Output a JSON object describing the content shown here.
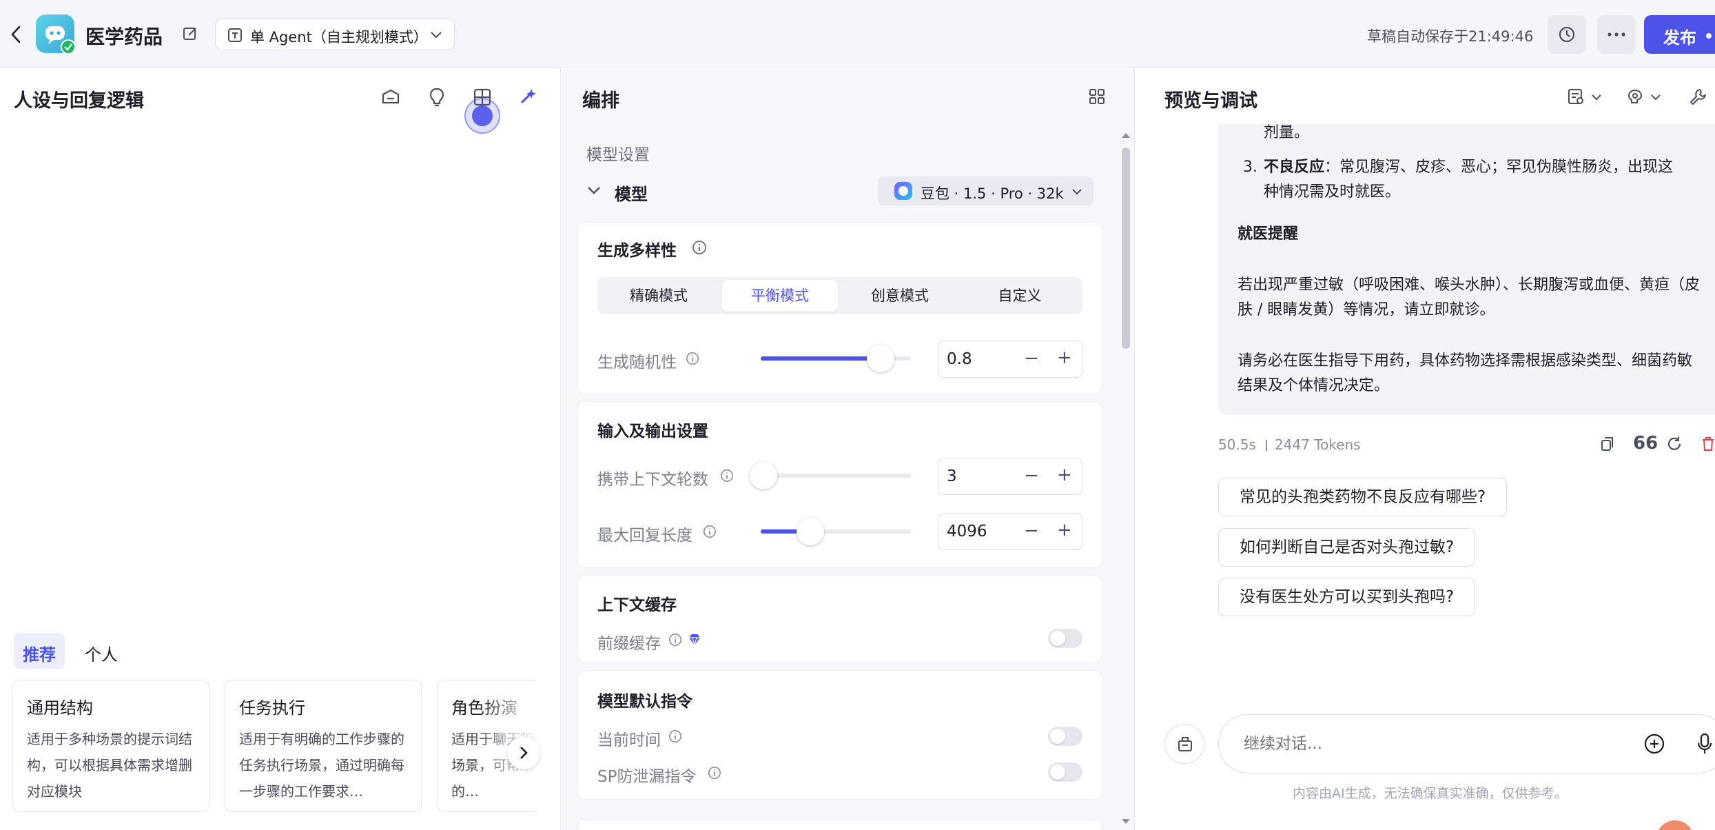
{
  "app": {
    "title": "医学药品",
    "agent_mode": "单 Agent（自主规划模式）",
    "autosave": "草稿自动保存于21:49:46",
    "publish_label": "发布"
  },
  "left": {
    "title": "人设与回复逻辑",
    "tabs": [
      "推荐",
      "个人"
    ],
    "templates": [
      {
        "title": "通用结构",
        "desc": "适用于多种场景的提示词结构，可以根据具体需求增删对应模块"
      },
      {
        "title": "任务执行",
        "desc": "适用于有明确的工作步骤的任务执行场景，通过明确每一步骤的工作要求…"
      },
      {
        "title": "角色扮演",
        "desc": "适用于聊天陪伴、互动娱乐场景，可帮助你塑造个性化的…"
      }
    ]
  },
  "middle": {
    "title": "编排",
    "model_settings": "模型设置",
    "model_label": "模型",
    "model_name": "豆包 · 1.5 · Pro · 32k",
    "diversity": {
      "title": "生成多样性",
      "modes": [
        "精确模式",
        "平衡模式",
        "创意模式",
        "自定义"
      ],
      "active_mode": "平衡模式",
      "randomness_label": "生成随机性",
      "randomness_value": "0.8",
      "randomness_fraction": 0.8
    },
    "io": {
      "title": "输入及输出设置",
      "context_label": "携带上下文轮数",
      "context_value": "3",
      "context_fraction": 0.02,
      "maxlen_label": "最大回复长度",
      "maxlen_value": "4096",
      "maxlen_fraction": 0.33
    },
    "cache": {
      "title": "上下文缓存",
      "prefix_label": "前缀缓存",
      "prefix_on": false
    },
    "defaults": {
      "title": "模型默认指令",
      "time_label": "当前时间",
      "time_on": false,
      "sp_label": "SP防泄漏指令",
      "sp_on": false
    }
  },
  "right": {
    "title": "预览与调试",
    "answer": {
      "line1": "剂量。",
      "item3_num": "3.",
      "item3_bold": "不良反应",
      "item3_text": "：常见腹泻、皮疹、恶心；罕见伪膜性肠炎，出现这种情况需及时就医。",
      "heading": "就医提醒",
      "p1": "若出现严重过敏（呼吸困难、喉头水肿）、长期腹泻或血便、黄疸（皮肤 / 眼睛发黄）等情况，请立即就诊。",
      "p2": "请务必在医生指导下用药，具体药物选择需根据感染类型、细菌药敏结果及个体情况决定。"
    },
    "meta_time": "50.5s",
    "meta_tokens": "2447 Tokens",
    "suggestions": [
      "常见的头孢类药物不良反应有哪些?",
      "如何判断自己是否对头孢过敏?",
      "没有医生处方可以买到头孢吗?"
    ],
    "input_placeholder": "继续对话...",
    "disclaimer": "内容由AI生成，无法确保真实准确，仅供参考。"
  },
  "colors": {
    "accent": "#4d53e8",
    "danger": "#e0464f"
  }
}
